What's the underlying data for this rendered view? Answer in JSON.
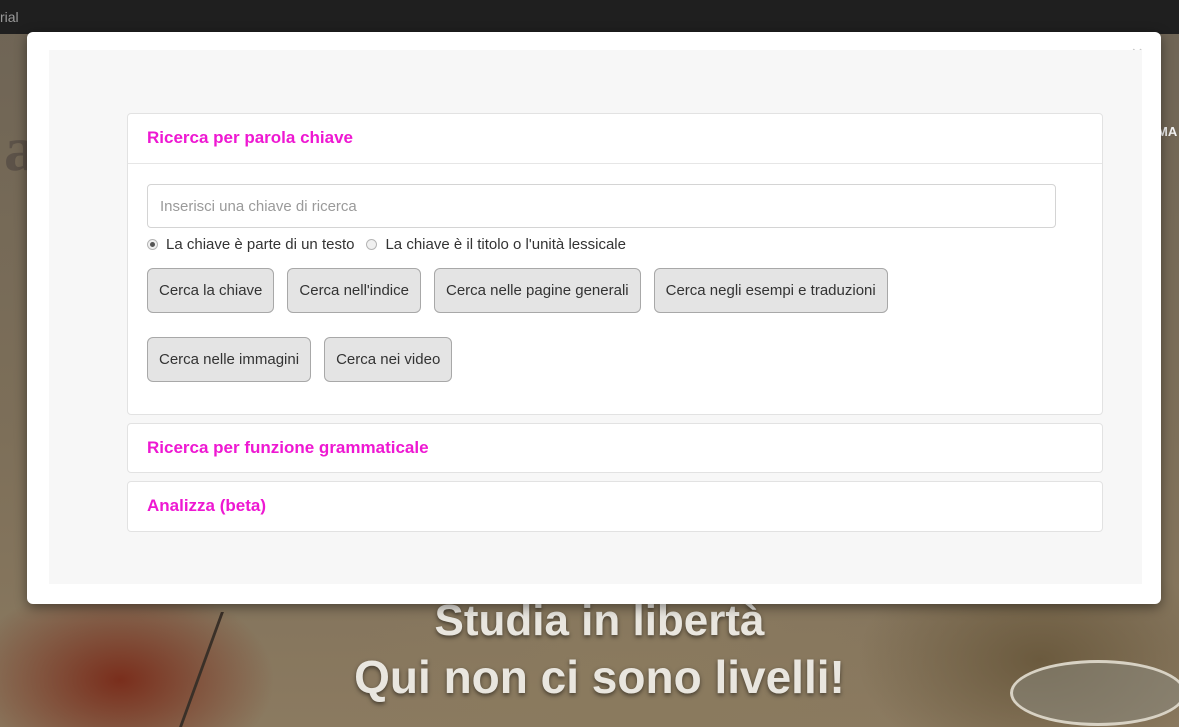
{
  "background": {
    "topbar_text": "rial",
    "right_label": "MA",
    "left_letter": "a",
    "hero_line1": "Studia in libertà",
    "hero_line2": "Qui non ci sono livelli!"
  },
  "modal": {
    "close_label": "×",
    "panels": [
      {
        "title": "Ricerca per parola chiave",
        "search_placeholder": "Inserisci una chiave di ricerca",
        "search_value": "",
        "radios": [
          {
            "label": "La chiave è parte di un testo",
            "checked": true
          },
          {
            "label": "La chiave è il titolo o l'unità lessicale",
            "checked": false
          }
        ],
        "buttons_row1": [
          "Cerca la chiave",
          "Cerca nell'indice",
          "Cerca nelle pagine generali",
          "Cerca negli esempi e traduzioni"
        ],
        "buttons_row2": [
          "Cerca nelle immagini",
          "Cerca nei video"
        ]
      },
      {
        "title": "Ricerca per funzione grammaticale"
      },
      {
        "title": "Analizza (beta)"
      }
    ]
  },
  "colors": {
    "accent": "#ee18d2",
    "button_bg": "#e4e4e4",
    "topbar": "#1f1f1f"
  }
}
